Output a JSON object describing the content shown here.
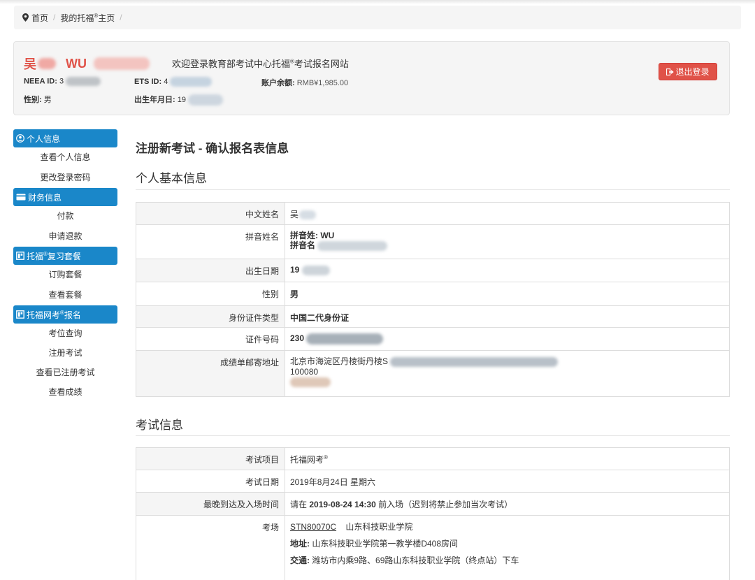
{
  "breadcrumb": {
    "home": "首页",
    "my_toefl": "我的托福",
    "my_toefl_sup": "®",
    "my_toefl_suffix": "主页"
  },
  "profile": {
    "name_cn": "吴",
    "name_en": "WU",
    "welcome_pre": "欢迎登录教育部考试中心托福",
    "welcome_sup": "®",
    "welcome_post": "考试报名网站",
    "neea_label": "NEEA ID:",
    "neea_value": "3",
    "ets_label": "ETS ID:",
    "ets_value": "4",
    "balance_label": "账户余额:",
    "balance_value": "RMB¥1,985.00",
    "gender_label": "性别:",
    "gender_value": "男",
    "dob_label": "出生年月日:",
    "dob_value": "19",
    "logout_label": "退出登录"
  },
  "sidebar": {
    "groups": [
      {
        "title": "个人信息",
        "items": [
          "查看个人信息",
          "更改登录密码"
        ]
      },
      {
        "title": "财务信息",
        "items": [
          "付款",
          "申请退款"
        ]
      },
      {
        "title_pre": "托福",
        "title_sup": "®",
        "title_post": "复习套餐",
        "items": [
          "订购套餐",
          "查看套餐"
        ]
      },
      {
        "title_pre": "托福网考",
        "title_sup": "®",
        "title_post": "报名",
        "items": [
          "考位查询",
          "注册考试",
          "查看已注册考试",
          "查看成绩"
        ]
      }
    ]
  },
  "main": {
    "page_title": "注册新考试 - 确认报名表信息",
    "personal_title": "个人基本信息",
    "personal": {
      "cn_name_label": "中文姓名",
      "cn_name_value": "吴",
      "pinyin_label": "拼音姓名",
      "pinyin_last": "拼音姓: WU",
      "pinyin_first": "拼音名",
      "dob_label": "出生日期",
      "dob_value": "19",
      "gender_label": "性别",
      "gender_value": "男",
      "id_type_label": "身份证件类型",
      "id_type_value": "中国二代身份证",
      "id_no_label": "证件号码",
      "id_no_value": "230",
      "addr_label": "成绩单邮寄地址",
      "addr_line1": "北京市海淀区丹棱街丹棱S",
      "addr_line2": "100080"
    },
    "exam_title": "考试信息",
    "exam": {
      "item_label": "考试项目",
      "item_value": "托福网考",
      "item_sup": "®",
      "date_label": "考试日期",
      "date_value": "2019年8月24日 星期六",
      "arrive_label": "最晚到达及入场时间",
      "arrive_pre": "请在 ",
      "arrive_time": "2019-08-24 14:30",
      "arrive_post": " 前入场（迟到将禁止参加当次考试）",
      "center_label": "考场",
      "center_code": "STN80070C",
      "center_name": "山东科技职业学院",
      "addr_label": "地址:",
      "addr_value": "山东科技职业学院第一教学楼D408房间",
      "traffic_label": "交通:",
      "traffic_value": "潍坊市内乘9路、69路山东科技职业学院（终点站）下车"
    }
  }
}
